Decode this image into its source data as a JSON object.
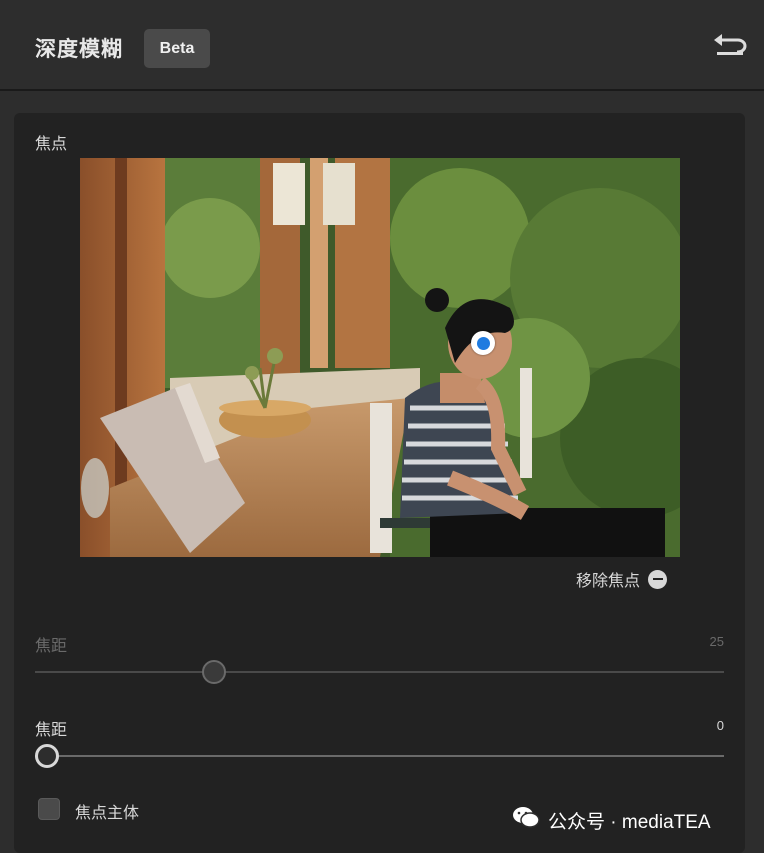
{
  "header": {
    "title": "深度模糊",
    "badge": "Beta",
    "reset_icon": "undo-arrow-icon"
  },
  "focus": {
    "label": "焦点",
    "remove_label": "移除焦点",
    "remove_icon": "minus-circle-icon",
    "point_color": "#1f7be0"
  },
  "sliders": [
    {
      "label": "焦距",
      "value": "25",
      "disabled": true
    },
    {
      "label": "焦距",
      "value": "0",
      "disabled": false
    }
  ],
  "checkbox": {
    "label": "焦点主体",
    "checked": false
  },
  "watermark": {
    "text": "公众号 · mediaTEA",
    "icon": "wechat-icon"
  }
}
